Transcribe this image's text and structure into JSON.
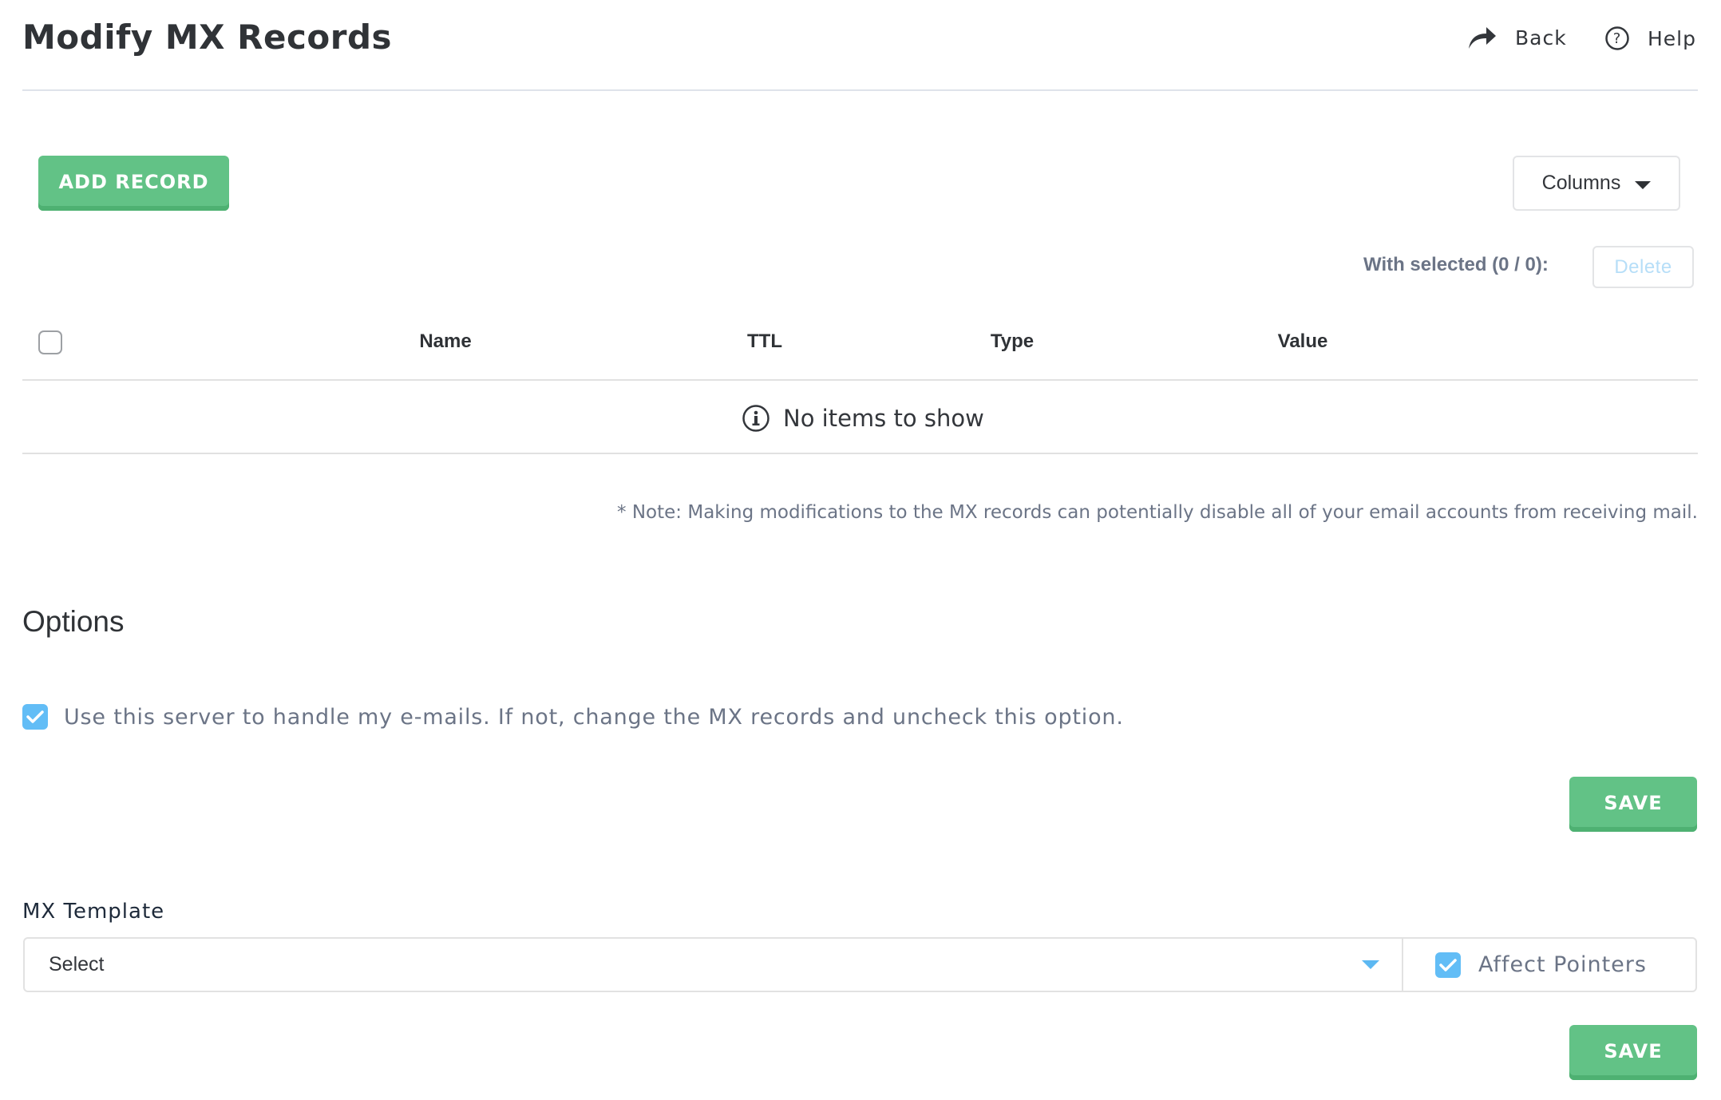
{
  "header": {
    "title": "Modify MX Records",
    "back_label": "Back",
    "back_icon": "share-arrow-icon",
    "help_label": "Help",
    "help_icon": "question-circle-icon"
  },
  "toolbar": {
    "add_record_label": "ADD RECORD",
    "columns_label": "Columns",
    "with_selected_label": "With selected (0 / 0):",
    "delete_label": "Delete"
  },
  "table": {
    "columns": [
      "Name",
      "TTL",
      "Type",
      "Value"
    ],
    "rows": [],
    "empty_message": "No items to show",
    "empty_icon": "info-circle-icon"
  },
  "note": "* Note: Making modifications to the MX records can potentially disable all of your email accounts from receiving mail.",
  "options": {
    "heading": "Options",
    "use_server_label": "Use this server to handle my e-mails. If not, change the MX records and uncheck this option.",
    "use_server_checked": true,
    "save_label": "SAVE"
  },
  "mx_template": {
    "label": "MX Template",
    "select_value": "Select",
    "affect_pointers_label": "Affect Pointers",
    "affect_pointers_checked": true,
    "save_label": "SAVE"
  },
  "colors": {
    "accent_green": "#62c286",
    "accent_blue": "#62bdf6",
    "disabled_text": "#b6def8"
  }
}
